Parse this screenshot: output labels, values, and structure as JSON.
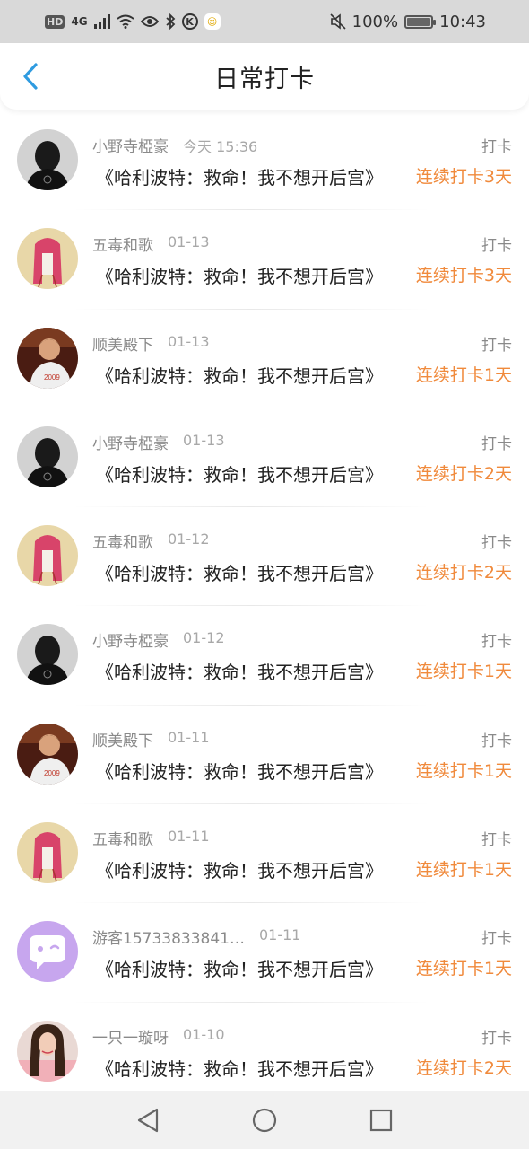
{
  "status_bar": {
    "hd": "HD",
    "network": "4G",
    "battery": "100%",
    "battery_level": 1.0,
    "time": "10:43",
    "icons": [
      "hd-icon",
      "signal-icon",
      "wifi-icon",
      "eye-icon",
      "bluetooth-icon",
      "k-circle-icon",
      "app-icon",
      "mute-icon",
      "battery-icon"
    ]
  },
  "header": {
    "title": "日常打卡",
    "back_icon": "chevron-left-icon",
    "accent": "#2f9be0"
  },
  "colors": {
    "streak": "#f08a3c",
    "meta": "#8a8a8a"
  },
  "entries": [
    {
      "name": "小野寺椏豪",
      "time": "今天 15:36",
      "label": "打卡",
      "content": "《哈利波特：救命！我不想开后宫》",
      "streak": "连续打卡3天",
      "avatar": "dark-silhouette"
    },
    {
      "name": "五毒和歌",
      "time": "01-13",
      "label": "打卡",
      "content": "《哈利波特：救命！我不想开后宫》",
      "streak": "连续打卡3天",
      "avatar": "pink-hair-drawing"
    },
    {
      "name": "顺美殿下",
      "time": "01-13",
      "label": "打卡",
      "content": "《哈利波特：救命！我不想开后宫》",
      "streak": "连续打卡1天",
      "avatar": "boy-photo"
    },
    {
      "name": "小野寺椏豪",
      "time": "01-13",
      "label": "打卡",
      "content": "《哈利波特：救命！我不想开后宫》",
      "streak": "连续打卡2天",
      "avatar": "dark-silhouette"
    },
    {
      "name": "五毒和歌",
      "time": "01-12",
      "label": "打卡",
      "content": "《哈利波特：救命！我不想开后宫》",
      "streak": "连续打卡2天",
      "avatar": "pink-hair-drawing"
    },
    {
      "name": "小野寺椏豪",
      "time": "01-12",
      "label": "打卡",
      "content": "《哈利波特：救命！我不想开后宫》",
      "streak": "连续打卡1天",
      "avatar": "dark-silhouette"
    },
    {
      "name": "顺美殿下",
      "time": "01-11",
      "label": "打卡",
      "content": "《哈利波特：救命！我不想开后宫》",
      "streak": "连续打卡1天",
      "avatar": "boy-photo"
    },
    {
      "name": "五毒和歌",
      "time": "01-11",
      "label": "打卡",
      "content": "《哈利波特：救命！我不想开后宫》",
      "streak": "连续打卡1天",
      "avatar": "pink-hair-drawing"
    },
    {
      "name": "游客15733833841…",
      "time": "01-11",
      "label": "打卡",
      "content": "《哈利波特：救命！我不想开后宫》",
      "streak": "连续打卡1天",
      "avatar": "purple-chat-bubble"
    },
    {
      "name": "一只一璇呀",
      "time": "01-10",
      "label": "打卡",
      "content": "《哈利波特：救命！我不想开后宫》",
      "streak": "连续打卡2天",
      "avatar": "girl-photo"
    }
  ],
  "nav_bar": {
    "icons": [
      "back-triangle-icon",
      "home-circle-icon",
      "recents-square-icon"
    ]
  }
}
